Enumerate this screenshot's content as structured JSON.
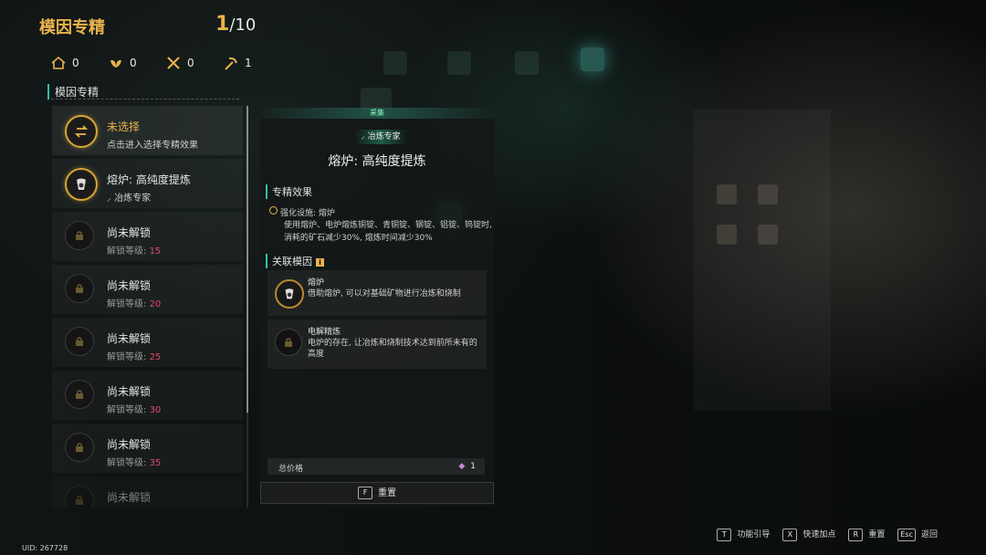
{
  "header": {
    "title": "模因专精",
    "count_current": "1",
    "count_total": "/10"
  },
  "stats": [
    {
      "icon": "house-icon",
      "value": "0"
    },
    {
      "icon": "leaf-icon",
      "value": "0"
    },
    {
      "icon": "tools-icon",
      "value": "0"
    },
    {
      "icon": "pickaxe-icon",
      "value": "1"
    }
  ],
  "list": {
    "section_label": "模因专精",
    "items": [
      {
        "title": "未选择",
        "subtitle": "点击进入选择专精效果",
        "state": "unselected"
      },
      {
        "title": "熔炉: 高纯度提炼",
        "subtitle": "冶炼专家",
        "state": "active"
      },
      {
        "title": "尚未解锁",
        "unlock_label": "解锁等级:",
        "level": "15",
        "state": "locked"
      },
      {
        "title": "尚未解锁",
        "unlock_label": "解锁等级:",
        "level": "20",
        "state": "locked"
      },
      {
        "title": "尚未解锁",
        "unlock_label": "解锁等级:",
        "level": "25",
        "state": "locked"
      },
      {
        "title": "尚未解锁",
        "unlock_label": "解锁等级:",
        "level": "30",
        "state": "locked"
      },
      {
        "title": "尚未解锁",
        "unlock_label": "解锁等级:",
        "level": "35",
        "state": "locked"
      },
      {
        "title": "尚未解锁",
        "unlock_label": "",
        "level": "",
        "state": "locked"
      }
    ]
  },
  "detail": {
    "category": "采集",
    "badge": "冶炼专家",
    "name": "熔炉: 高纯度提炼",
    "effect_heading": "专精效果",
    "effect_title": "强化设施: 熔炉",
    "effect_desc": "使用熔炉、电炉熔炼铜锭、青铜锭、钢锭、铝锭、钨锭时, 消耗的矿石减少30%, 熔炼时间减少30%",
    "genes_heading": "关联模因",
    "genes": [
      {
        "name": "熔炉",
        "desc": "借助熔炉, 可以对基础矿物进行冶炼和烧制",
        "state": "owned"
      },
      {
        "name": "电解精炼",
        "desc": "电炉的存在, 让冶炼和烧制技术达到前所未有的高度",
        "state": "locked"
      }
    ],
    "price_label": "总价格",
    "price_value": "1",
    "reset_key": "F",
    "reset_label": "重置"
  },
  "footer": [
    {
      "key": "T",
      "label": "功能引导"
    },
    {
      "key": "X",
      "label": "快速加点"
    },
    {
      "key": "R",
      "label": "重置"
    },
    {
      "key": "Esc",
      "label": "返回"
    }
  ],
  "uid": "UID: 267728",
  "colors": {
    "accent_gold": "#e9b44c",
    "accent_teal": "#2fc1a9",
    "level_red": "#e0476a"
  }
}
